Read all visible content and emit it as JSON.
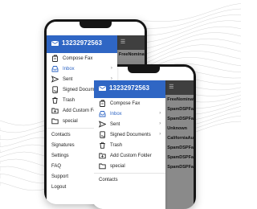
{
  "back_phone": {
    "phone_number": "13232972563",
    "menu": [
      {
        "label": "Compose Fax",
        "icon": "compose-fax-icon",
        "active": false
      },
      {
        "label": "Inbox",
        "icon": "inbox-icon",
        "active": true
      },
      {
        "label": "Sent",
        "icon": "sent-icon",
        "active": false
      },
      {
        "label": "Signed Documents",
        "icon": "signed-documents-icon",
        "active": false
      },
      {
        "label": "Trash",
        "icon": "trash-icon",
        "active": false
      },
      {
        "label": "Add Custom Folder",
        "icon": "add-folder-icon",
        "active": false
      },
      {
        "label": "special",
        "icon": "folder-icon",
        "active": false
      }
    ],
    "links": [
      "Contacts",
      "Signatures",
      "Settings",
      "FAQ",
      "Support",
      "Logout"
    ],
    "list_preview": [
      "FreeNomination"
    ]
  },
  "front_phone": {
    "phone_number": "13232972563",
    "menu": [
      {
        "label": "Compose Fax",
        "icon": "compose-fax-icon",
        "active": false
      },
      {
        "label": "Inbox",
        "icon": "inbox-icon",
        "active": true
      },
      {
        "label": "Sent",
        "icon": "sent-icon",
        "active": false
      },
      {
        "label": "Signed Documents",
        "icon": "signed-documents-icon",
        "active": false
      },
      {
        "label": "Trash",
        "icon": "trash-icon",
        "active": false
      },
      {
        "label": "Add Custom Folder",
        "icon": "add-folder-icon",
        "active": false
      },
      {
        "label": "special",
        "icon": "folder-icon",
        "active": false
      }
    ],
    "links": [
      "Contacts"
    ],
    "list_preview": [
      "FreeNomination",
      "SpamDSPFaxInbox",
      "SpamDSPFaxInbox",
      "Unknown",
      "CaliforniaAuto",
      "SpamDSPFaxInbox",
      "SpamDSPFaxInbox",
      "SpamDSPFaxInbox"
    ]
  },
  "colors": {
    "header_blue": "#2f66c4",
    "active_blue": "#2f66c4",
    "phone_frame": "#151515",
    "dark_toolbar": "#3f3f3f",
    "list_grey": "#8a8a8a",
    "background_lines": "#d4d4d4"
  }
}
